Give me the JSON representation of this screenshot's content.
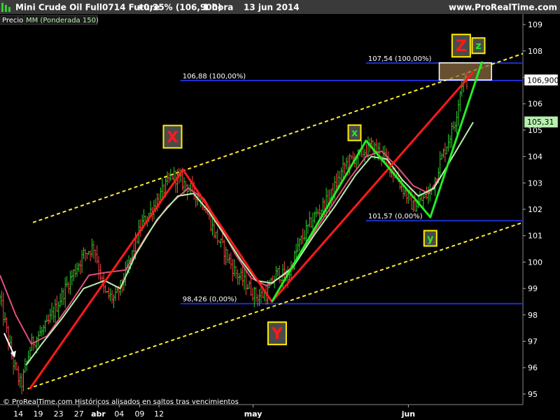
{
  "header": {
    "title": "Mini Crude Oil Full0714 Future",
    "change": "+0,35% (106,900)",
    "timeframe": "1 hora",
    "date": "13 jun 2014",
    "site": "www.ProRealTime.com"
  },
  "indicator_labels": {
    "price": "Precio",
    "ma": "MM (Ponderada 150)"
  },
  "footer": {
    "copyright": "© ProRealTime.com Históricos alisados en saltos tras vencimientos"
  },
  "colors": {
    "background": "#000000",
    "up_bar": "#2ed12e",
    "down_bar": "#ff4040",
    "wma_fast": "#e0507a",
    "wma_slow": "#b8f0b0",
    "channel": "#ffee33",
    "fib_line": "#1b2fd0",
    "wave_red": "#ff1a1a",
    "wave_green": "#22ee22",
    "label_box": "#ffee00"
  },
  "chart_data": {
    "type": "line",
    "ylim": [
      94.6,
      109.4
    ],
    "xlim": [
      0,
      100
    ],
    "y_ticks": [
      "95",
      "96",
      "97",
      "98",
      "99",
      "100",
      "101",
      "102",
      "103",
      "104",
      "105",
      "106",
      "107",
      "108",
      "109"
    ],
    "x_ticks": [
      {
        "label": "14",
        "x": 3.5
      },
      {
        "label": "19",
        "x": 7.3
      },
      {
        "label": "23",
        "x": 11.2
      },
      {
        "label": "27",
        "x": 15.1
      },
      {
        "label": "abr",
        "x": 18.8
      },
      {
        "label": "04",
        "x": 22.8
      },
      {
        "label": "09",
        "x": 26.7
      },
      {
        "label": "12",
        "x": 30.4
      },
      {
        "label": "may",
        "x": 48.4
      },
      {
        "label": "jun",
        "x": 78.1
      }
    ],
    "price_bars": {
      "name": "Precio",
      "keypoints": [
        [
          0,
          98.6
        ],
        [
          2.5,
          96.2
        ],
        [
          4,
          95.3
        ],
        [
          6,
          96.9
        ],
        [
          9,
          97.6
        ],
        [
          13,
          99.2
        ],
        [
          16,
          100.3
        ],
        [
          18,
          100.6
        ],
        [
          20,
          98.8
        ],
        [
          22,
          98.6
        ],
        [
          24,
          99.5
        ],
        [
          27,
          101.4
        ],
        [
          30,
          102.3
        ],
        [
          33,
          103.3
        ],
        [
          35,
          103.0
        ],
        [
          37,
          102.7
        ],
        [
          39,
          102.2
        ],
        [
          41,
          101.1
        ],
        [
          43,
          100.4
        ],
        [
          45,
          99.6
        ],
        [
          47,
          99.2
        ],
        [
          49,
          98.7
        ],
        [
          51,
          98.8
        ],
        [
          53,
          99.6
        ],
        [
          55,
          99.4
        ],
        [
          57,
          100.6
        ],
        [
          60,
          101.7
        ],
        [
          63,
          102.4
        ],
        [
          66,
          103.7
        ],
        [
          69,
          104.1
        ],
        [
          71,
          104.4
        ],
        [
          73,
          104.1
        ],
        [
          75,
          103.5
        ],
        [
          77,
          102.8
        ],
        [
          79,
          102.1
        ],
        [
          81,
          102.4
        ],
        [
          82.5,
          102.7
        ],
        [
          84,
          103.7
        ],
        [
          85.5,
          104.5
        ],
        [
          87,
          105.3
        ],
        [
          88.3,
          106.8
        ],
        [
          89.5,
          106.9
        ]
      ]
    },
    "wma_fast": {
      "name": "MM (Ponderada 150)",
      "points": [
        [
          0,
          99.5
        ],
        [
          3,
          98.0
        ],
        [
          6,
          96.9
        ],
        [
          9,
          97.2
        ],
        [
          13,
          98.3
        ],
        [
          17,
          99.5
        ],
        [
          20,
          99.6
        ],
        [
          24,
          99.7
        ],
        [
          28,
          101.0
        ],
        [
          32,
          102.1
        ],
        [
          36,
          102.8
        ],
        [
          39,
          102.4
        ],
        [
          42,
          101.4
        ],
        [
          45,
          100.3
        ],
        [
          48,
          99.4
        ],
        [
          51,
          99.1
        ],
        [
          55,
          99.6
        ],
        [
          59,
          100.8
        ],
        [
          63,
          102.0
        ],
        [
          67,
          103.2
        ],
        [
          70,
          104.0
        ],
        [
          73,
          104.2
        ],
        [
          76,
          103.6
        ],
        [
          79,
          102.9
        ],
        [
          82,
          102.6
        ],
        [
          84,
          103.2
        ]
      ]
    },
    "wma_slow": {
      "name": "",
      "points": [
        [
          5,
          96.1
        ],
        [
          8,
          96.9
        ],
        [
          12,
          97.9
        ],
        [
          16,
          99.0
        ],
        [
          20,
          99.3
        ],
        [
          23,
          99.0
        ],
        [
          26,
          100.3
        ],
        [
          30,
          101.6
        ],
        [
          34,
          102.5
        ],
        [
          37,
          102.6
        ],
        [
          40,
          101.9
        ],
        [
          43,
          101.0
        ],
        [
          46,
          100.1
        ],
        [
          49,
          99.3
        ],
        [
          52,
          99.2
        ],
        [
          56,
          99.8
        ],
        [
          60,
          101.0
        ],
        [
          64,
          102.1
        ],
        [
          68,
          103.3
        ],
        [
          71,
          104.0
        ],
        [
          74,
          103.9
        ],
        [
          77,
          103.1
        ],
        [
          80,
          102.5
        ],
        [
          83,
          102.8
        ],
        [
          86,
          103.8
        ],
        [
          89,
          104.8
        ],
        [
          90.5,
          105.3
        ]
      ]
    },
    "channel_upper": {
      "points": [
        [
          6.3,
          101.5
        ],
        [
          100,
          107.9
        ]
      ]
    },
    "channel_lower": {
      "points": [
        [
          5.3,
          95.2
        ],
        [
          100,
          101.5
        ]
      ]
    },
    "fib_levels": [
      {
        "label": "107,54 (100,00%)",
        "y": 107.54,
        "x_start": 70
      },
      {
        "label": "106,88 (100,00%)",
        "y": 106.88,
        "x_start": 34.5
      },
      {
        "label": "101,57 (0,00%)",
        "y": 101.57,
        "x_start": 70
      },
      {
        "label": "98,426 (0,00%)",
        "y": 98.426,
        "x_start": 34.5
      }
    ],
    "wave_red": {
      "points": [
        [
          5.7,
          95.2
        ],
        [
          35,
          103.5
        ],
        [
          52,
          98.5
        ],
        [
          90.5,
          107.2
        ]
      ],
      "labels": [
        {
          "text": "X",
          "x": 33,
          "y": 104.75
        },
        {
          "text": "Y",
          "x": 53,
          "y": 97.3
        },
        {
          "text": "Z",
          "x": 88.2,
          "y": 108.2
        }
      ]
    },
    "wave_green": {
      "points": [
        [
          52,
          98.5
        ],
        [
          70,
          104.6
        ],
        [
          82.3,
          101.7
        ],
        [
          92.2,
          107.6
        ]
      ],
      "labels": [
        {
          "text": "x",
          "x": 67.8,
          "y": 104.9
        },
        {
          "text": "y",
          "x": 82.3,
          "y": 100.9
        },
        {
          "text": "z",
          "x": 91.5,
          "y": 108.2
        }
      ]
    },
    "target_zone": {
      "x_range": [
        84,
        94
      ],
      "y_range": [
        106.9,
        107.55
      ]
    },
    "last_price": {
      "label": "106,900",
      "value": 106.9
    },
    "wma_last": {
      "label": "105,31",
      "value": 105.31
    }
  }
}
